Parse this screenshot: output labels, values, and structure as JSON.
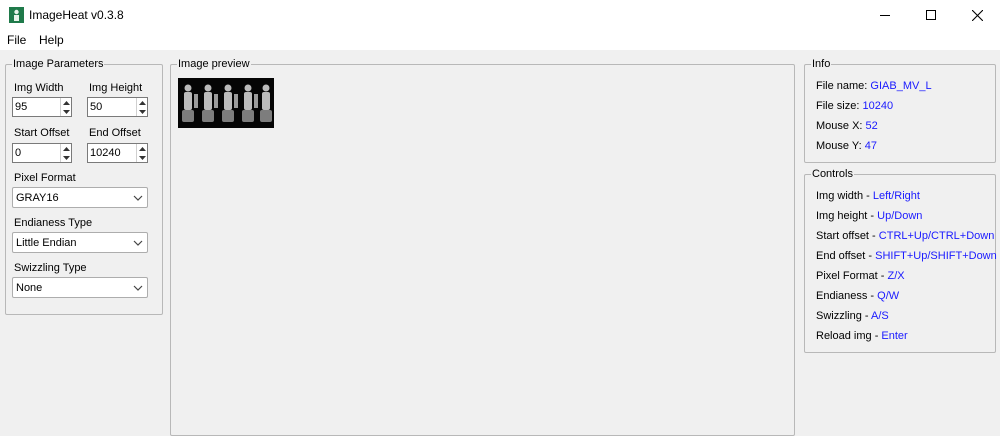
{
  "window": {
    "title": "ImageHeat v0.3.8",
    "app_icon": "imageheat-app-icon",
    "buttons": [
      "minimize-icon",
      "maximize-icon",
      "close-icon"
    ]
  },
  "menu": {
    "items": [
      "File",
      "Help"
    ]
  },
  "image_parameters": {
    "legend": "Image Parameters",
    "img_width_label": "Img Width",
    "img_width_value": "95",
    "img_height_label": "Img Height",
    "img_height_value": "50",
    "start_offset_label": "Start Offset",
    "start_offset_value": "0",
    "end_offset_label": "End Offset",
    "end_offset_value": "10240",
    "pixel_format_label": "Pixel Format",
    "pixel_format_value": "GRAY16",
    "endianess_label": "Endianess Type",
    "endianess_value": "Little Endian",
    "swizzling_label": "Swizzling Type",
    "swizzling_value": "None"
  },
  "preview": {
    "legend": "Image preview"
  },
  "info": {
    "legend": "Info",
    "rows": [
      {
        "label": "File name: ",
        "value": "GIAB_MV_L"
      },
      {
        "label": "File size: ",
        "value": "10240"
      },
      {
        "label": "Mouse X: ",
        "value": "52"
      },
      {
        "label": "Mouse Y: ",
        "value": "47"
      }
    ]
  },
  "controls": {
    "legend": "Controls",
    "rows": [
      {
        "label": "Img width - ",
        "value": "Left/Right"
      },
      {
        "label": "Img height - ",
        "value": "Up/Down"
      },
      {
        "label": "Start offset - ",
        "value": "CTRL+Up/CTRL+Down"
      },
      {
        "label": "End offset - ",
        "value": "SHIFT+Up/SHIFT+Down"
      },
      {
        "label": "Pixel Format - ",
        "value": "Z/X"
      },
      {
        "label": "Endianess - ",
        "value": "Q/W"
      },
      {
        "label": "Swizzling - ",
        "value": "A/S"
      },
      {
        "label": "Reload img - ",
        "value": "Enter"
      }
    ]
  },
  "colors": {
    "value_blue": "#1a1aff",
    "window_bg": "#f0f0f0",
    "group_border": "#b8b8b8"
  }
}
